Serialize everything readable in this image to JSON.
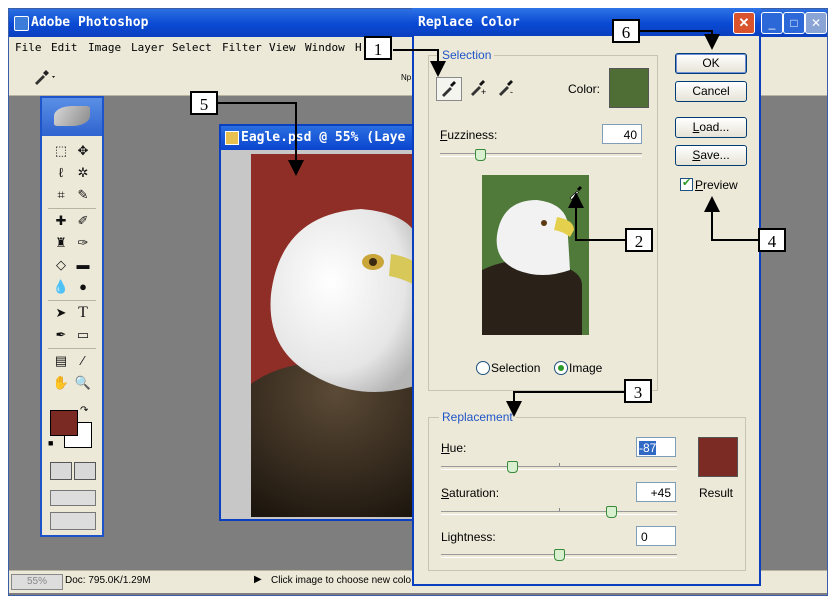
{
  "app": {
    "title": "Adobe Photoshop",
    "menu": [
      "File",
      "Edit",
      "Image",
      "Layer",
      "Select",
      "Filter",
      "View",
      "Window",
      "H"
    ],
    "options_tool_icon": "eyedropper-icon",
    "options_fragment": "Np"
  },
  "document": {
    "title": "Eagle.psd @ 55% (Laye"
  },
  "statusbar": {
    "zoom": "55%",
    "doc_size": "Doc: 795.0K/1.29M",
    "message": "Click image to choose new colo"
  },
  "dialog": {
    "title": "Replace Color",
    "selection_legend": "Selection",
    "color_label": "Color:",
    "color_swatch": "#4f6e35",
    "fuzziness_label": "Fuzziness:",
    "fuzziness_value": "40",
    "fuzziness_level": 0.2,
    "radio_selection": "Selection",
    "radio_image": "Image",
    "radio_selected": "image",
    "replacement_legend": "Replacement",
    "hue_label": "Hue:",
    "hue_value": "-87",
    "hue_level": 0.3,
    "saturation_label": "Saturation:",
    "saturation_value": "+45",
    "saturation_level": 0.72,
    "lightness_label": "Lightness:",
    "lightness_value": "0",
    "lightness_level": 0.5,
    "result_label": "Result",
    "result_swatch": "#7b2b24",
    "buttons": {
      "ok": "OK",
      "cancel": "Cancel",
      "load": "Load...",
      "save": "Save..."
    },
    "preview_label": "Preview",
    "preview_checked": true
  },
  "callouts": [
    "1",
    "2",
    "3",
    "4",
    "5",
    "6"
  ],
  "colors": {
    "xp_blue": "#0a4ad4",
    "canvas_red": "#8f2d27",
    "preview_green": "#4f7a3a"
  }
}
